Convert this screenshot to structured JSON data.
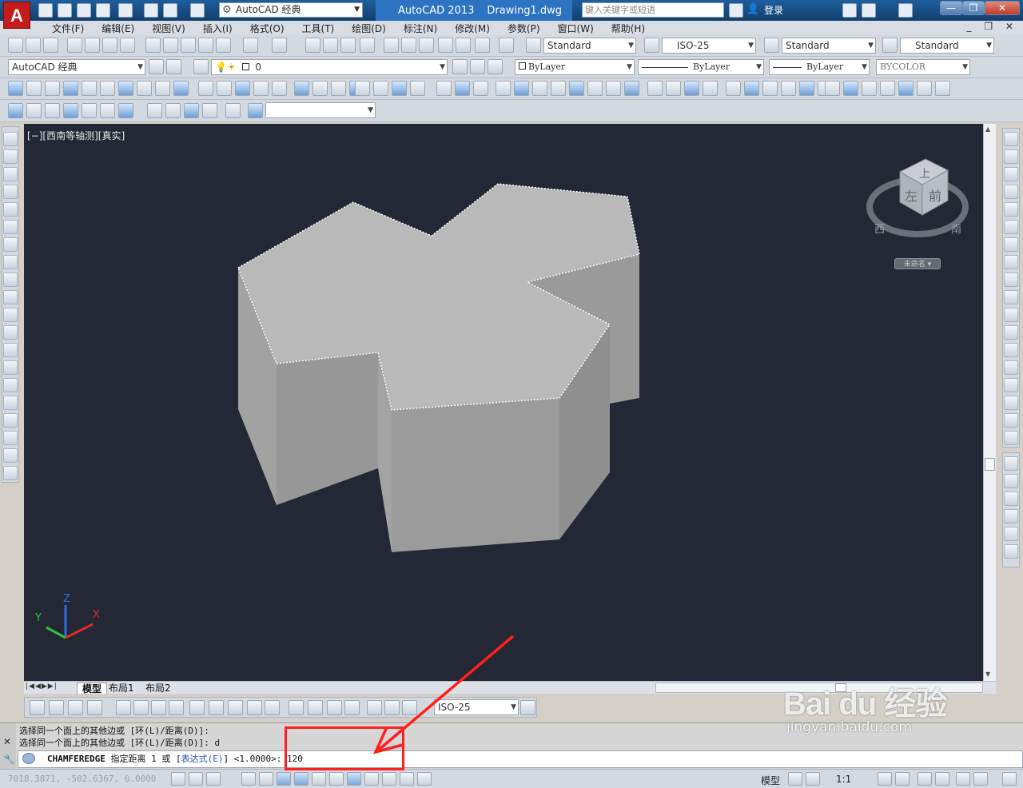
{
  "app": {
    "logo": "A",
    "workspace": "AutoCAD 经典",
    "title_app": "AutoCAD 2013",
    "title_doc": "Drawing1.dwg",
    "search_placeholder": "键入关键字或短语",
    "login": "登录"
  },
  "menu": [
    "文件(F)",
    "编辑(E)",
    "视图(V)",
    "插入(I)",
    "格式(O)",
    "工具(T)",
    "绘图(D)",
    "标注(N)",
    "修改(M)",
    "参数(P)",
    "窗口(W)",
    "帮助(H)"
  ],
  "styles": {
    "text_style": "Standard",
    "dim_style": "ISO-25",
    "table_style": "Standard",
    "multileader_style": "Standard"
  },
  "layers": {
    "workspace2": "AutoCAD 经典",
    "current_layer": "0",
    "color": "ByLayer",
    "linetype": "ByLayer",
    "lineweight": "ByLayer",
    "plotstyle": "BYCOLOR"
  },
  "viewport": {
    "label": "[−][西南等轴测][真实]",
    "viewcube_labels": {
      "top": "上",
      "left": "左",
      "front": "前",
      "west": "西",
      "south": "南"
    },
    "view_name": "未命名 ▾",
    "ucs": {
      "x": "X",
      "y": "Y",
      "z": "Z"
    }
  },
  "layout_tabs": [
    "模型",
    "布局1",
    "布局2"
  ],
  "dim_toolbar": {
    "dim_style": "ISO-25"
  },
  "command": {
    "history": [
      "选择同一个面上的其他边或 [环(L)/距离(D)]:",
      "选择同一个面上的其他边或 [环(L)/距离(D)]: d"
    ],
    "command_name": "CHAMFEREDGE",
    "prompt": " 指定距离 1 或 [",
    "option": "表达式(E)",
    "prompt_tail": "] <1.0000>: ",
    "input": "120"
  },
  "status": {
    "coords": "7018.3871, -502.6367, 0.0000",
    "model": "模型",
    "scale": "1:1"
  },
  "watermark": {
    "brand": "Bai du 经验",
    "url": "jingyan.baidu.com"
  },
  "colors": {
    "viewport_bg": "#232834",
    "highlight": "#ff1f1f",
    "title_bar": "#1e5e9c"
  }
}
